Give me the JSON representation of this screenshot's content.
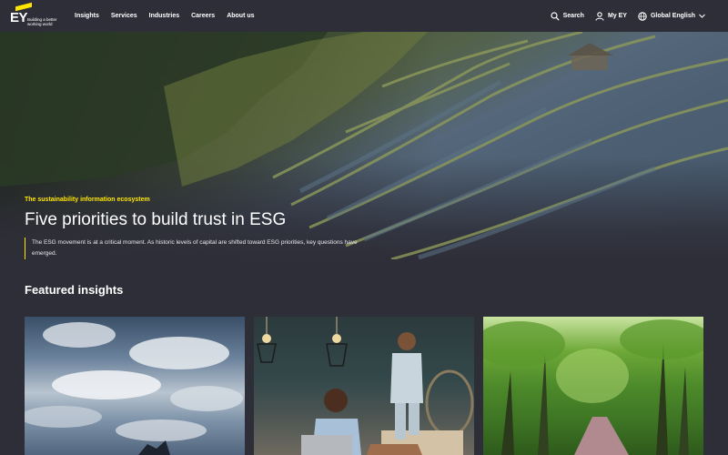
{
  "nav": {
    "brand": "EY",
    "tagline": "Building a better working world",
    "links": [
      "Insights",
      "Services",
      "Industries",
      "Careers",
      "About us"
    ],
    "search_label": "Search",
    "account_label": "My EY",
    "language_label": "Global English"
  },
  "hero": {
    "eyebrow": "The sustainability information ecosystem",
    "title": "Five priorities to build trust in ESG",
    "description": "The ESG movement is at a critical moment. As historic levels of capital are shifted toward ESG priorities, key questions have emerged."
  },
  "featured": {
    "title": "Featured insights"
  },
  "colors": {
    "background": "#2e2e38",
    "accent": "#ffe600",
    "text": "#ffffff"
  }
}
